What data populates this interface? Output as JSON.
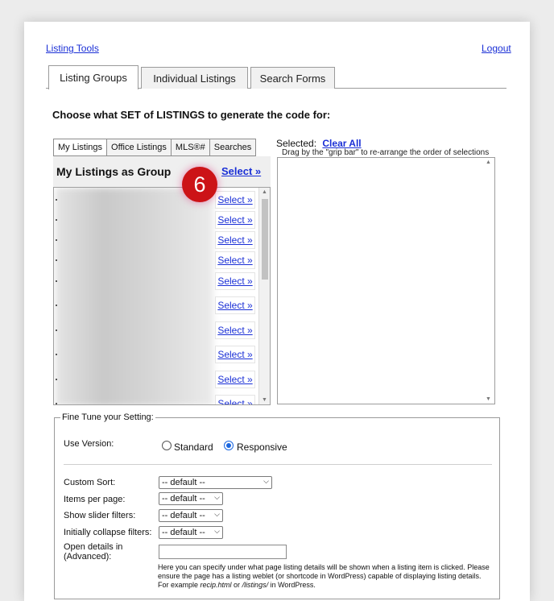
{
  "top": {
    "listing_tools": "Listing Tools",
    "logout": "Logout"
  },
  "tabs": [
    {
      "label": "Listing Groups",
      "active": true
    },
    {
      "label": "Individual Listings",
      "active": false
    },
    {
      "label": "Search Forms",
      "active": false
    }
  ],
  "heading": "Choose what SET of LISTINGS to generate the code for:",
  "subtabs": [
    {
      "label": "My Listings",
      "active": true
    },
    {
      "label": "Office Listings"
    },
    {
      "label": "MLS®#"
    },
    {
      "label": "Searches"
    }
  ],
  "group": {
    "title": "My Listings as Group",
    "select_label": "Select »"
  },
  "step_badge": "6",
  "list": {
    "row_select_label": "Select »",
    "rows": [
      "Select »",
      "Select »",
      "Select »",
      "Select »",
      "Select »",
      "Select »",
      "Select »",
      "Select »",
      "Select »",
      "Select »"
    ]
  },
  "selected": {
    "label": "Selected:",
    "clear_all": "Clear All",
    "hint": "Drag by the \"grip bar\" to re-arrange the order of selections"
  },
  "fine_tune": {
    "legend": "Fine Tune your Setting:",
    "use_version": {
      "label": "Use Version:",
      "options": [
        "Standard",
        "Responsive"
      ],
      "selected": "Responsive"
    },
    "custom_sort": {
      "label": "Custom Sort:",
      "value": "-- default --"
    },
    "items_per_page": {
      "label": "Items per page:",
      "value": "-- default --"
    },
    "show_slider_filters": {
      "label": "Show slider filters:",
      "value": "-- default --"
    },
    "initially_collapse_filters": {
      "label": "Initially collapse filters:",
      "value": "-- default --"
    },
    "open_details": {
      "label_line1": "Open details in",
      "label_line2": "(Advanced):",
      "value": ""
    },
    "help_part1": "Here you can specify under what page listing details will be shown when a listing item is clicked. Please ensure the page has a listing weblet (or shortcode in WordPress) capable of displaying listing details. For example ",
    "help_example1": "recip.html",
    "help_or": " or ",
    "help_example2": "/listings/",
    "help_end": " in WordPress."
  },
  "colors": {
    "link": "#1a2fd6",
    "badge": "#cc1317",
    "radio_checked": "#1a66e0"
  }
}
